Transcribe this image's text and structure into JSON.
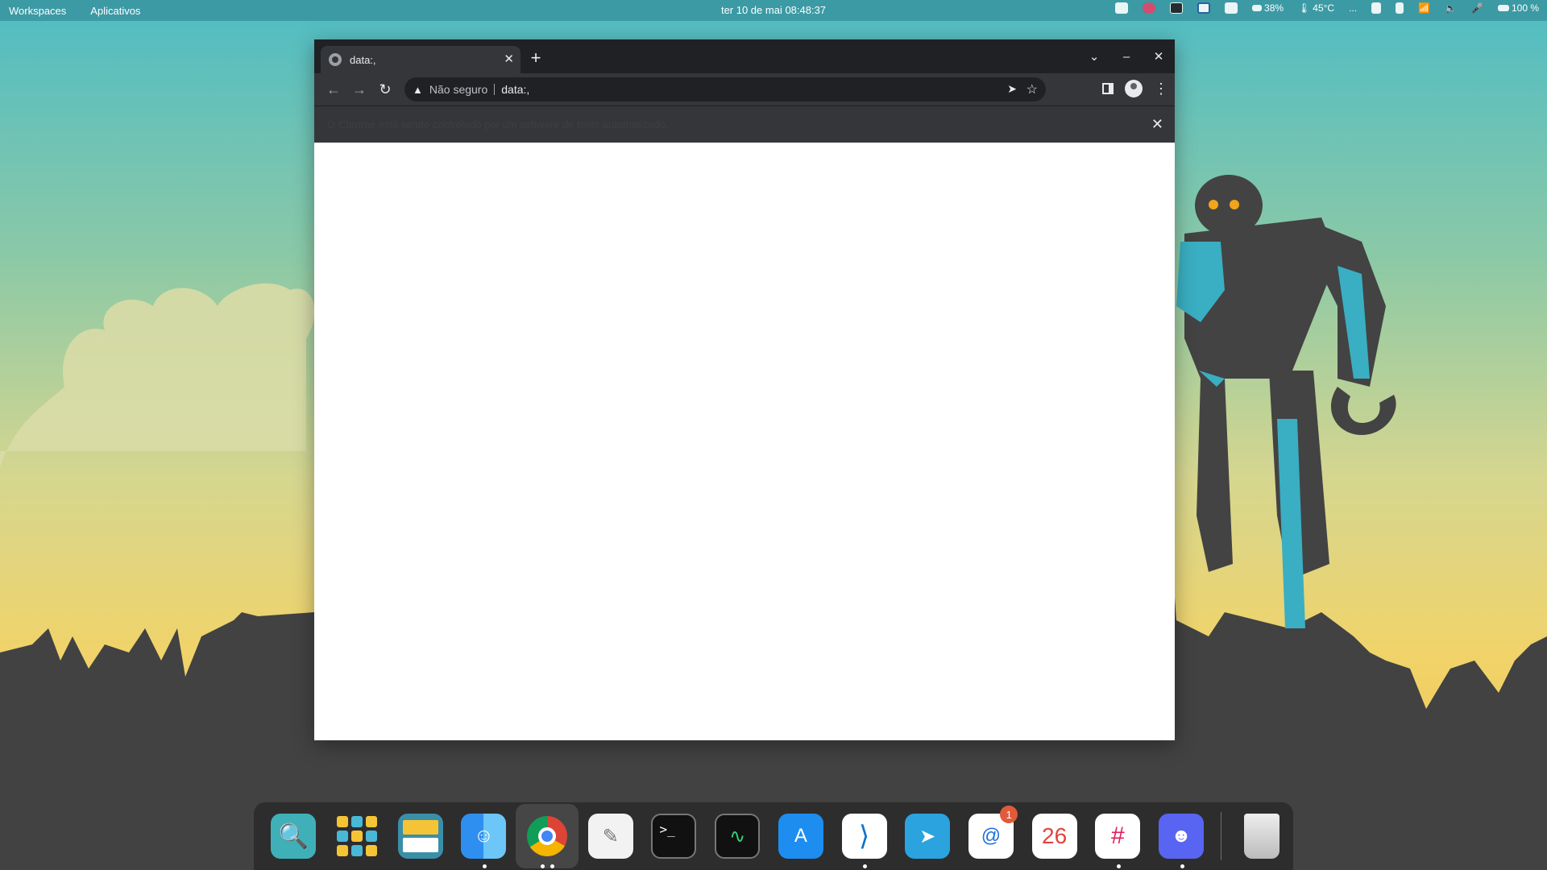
{
  "topbar": {
    "workspaces": "Workspaces",
    "apps": "Aplicativos",
    "clock": "ter 10 de mai  08:48:37",
    "battery_pct_a": "38%",
    "temperature": "45°C",
    "ellipsis": "...",
    "battery_pct_b": "100 %"
  },
  "browser": {
    "tab_title": "data:,",
    "security_label": "Não seguro",
    "url": "data:,",
    "infobar_text": "O Chrome está sendo controlado por um software de teste automatizado."
  },
  "dock": {
    "apps": [
      {
        "name": "search",
        "icon": "magnifier-icon"
      },
      {
        "name": "app-grid",
        "icon": "grid-icon"
      },
      {
        "name": "workspaces",
        "icon": "windows-icon"
      },
      {
        "name": "finder",
        "icon": "finder-face-icon",
        "running": true
      },
      {
        "name": "chrome",
        "icon": "chrome-icon",
        "running": true,
        "windows": 2
      },
      {
        "name": "text-editor",
        "icon": "notepad-icon"
      },
      {
        "name": "terminal",
        "icon": "terminal-icon"
      },
      {
        "name": "activity-monitor",
        "icon": "heartbeat-icon"
      },
      {
        "name": "app-store",
        "icon": "app-store-icon"
      },
      {
        "name": "vscode",
        "icon": "vscode-icon",
        "running": true
      },
      {
        "name": "telegram",
        "icon": "paper-plane-icon"
      },
      {
        "name": "mail",
        "icon": "at-sign-icon",
        "badge": "1"
      },
      {
        "name": "calendar",
        "icon": "calendar-icon",
        "day": "26"
      },
      {
        "name": "slack",
        "icon": "slack-icon",
        "running": true
      },
      {
        "name": "discord",
        "icon": "discord-icon",
        "running": true
      },
      {
        "name": "trash",
        "icon": "trash-icon"
      }
    ]
  },
  "colors": {
    "topbar": "#3b9aa4",
    "chrome_dark": "#202124",
    "chrome_toolbar": "#35363a",
    "robot_body": "#434343",
    "robot_accent": "#3aaec2"
  }
}
